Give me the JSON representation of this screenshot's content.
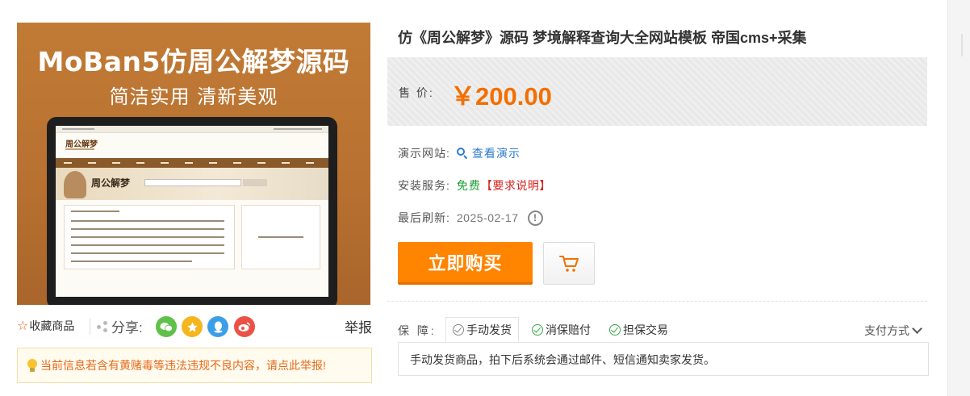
{
  "product_image": {
    "headline": "MoBan5仿周公解梦源码",
    "subline": "简洁实用  清新美观",
    "screen_logo": "周公解梦",
    "screen_banner_text": "周公解梦"
  },
  "left_actions": {
    "favorite_label": "收藏商品",
    "share_label": "分享:",
    "report_label": "举报",
    "social_icons": [
      "wechat-icon",
      "qzone-icon",
      "qq-icon",
      "weibo-icon"
    ]
  },
  "warning": {
    "text": "当前信息若含有黄赌毒等违法违规不良内容，请点此举报!"
  },
  "product": {
    "title": "仿《周公解梦》源码 梦境解释查询大全网站模板 帝国cms+采集",
    "price_label": "售 价:",
    "price": "￥200.00",
    "demo_label": "演示网站:",
    "demo_link": "查看演示",
    "install_label": "安装服务:",
    "install_value": "免费",
    "install_note": "【要求说明】",
    "refresh_label": "最后刷新:",
    "refresh_date": "2025-02-17",
    "buy_label": "立即购买"
  },
  "guarantee": {
    "label": "保 障:",
    "tabs": [
      {
        "label": "手动发货",
        "active": true
      },
      {
        "label": "消保赔付",
        "active": false
      },
      {
        "label": "担保交易",
        "active": false
      }
    ],
    "payment_label": "支付方式",
    "content": "手动发货商品，拍下后系统会通过邮件、短信通知卖家发货。"
  },
  "colors": {
    "accent_orange": "#ff8400",
    "price_orange": "#f36f02",
    "link_blue": "#2a7bd0",
    "free_green": "#1d9d35",
    "note_red": "#d8221c"
  }
}
